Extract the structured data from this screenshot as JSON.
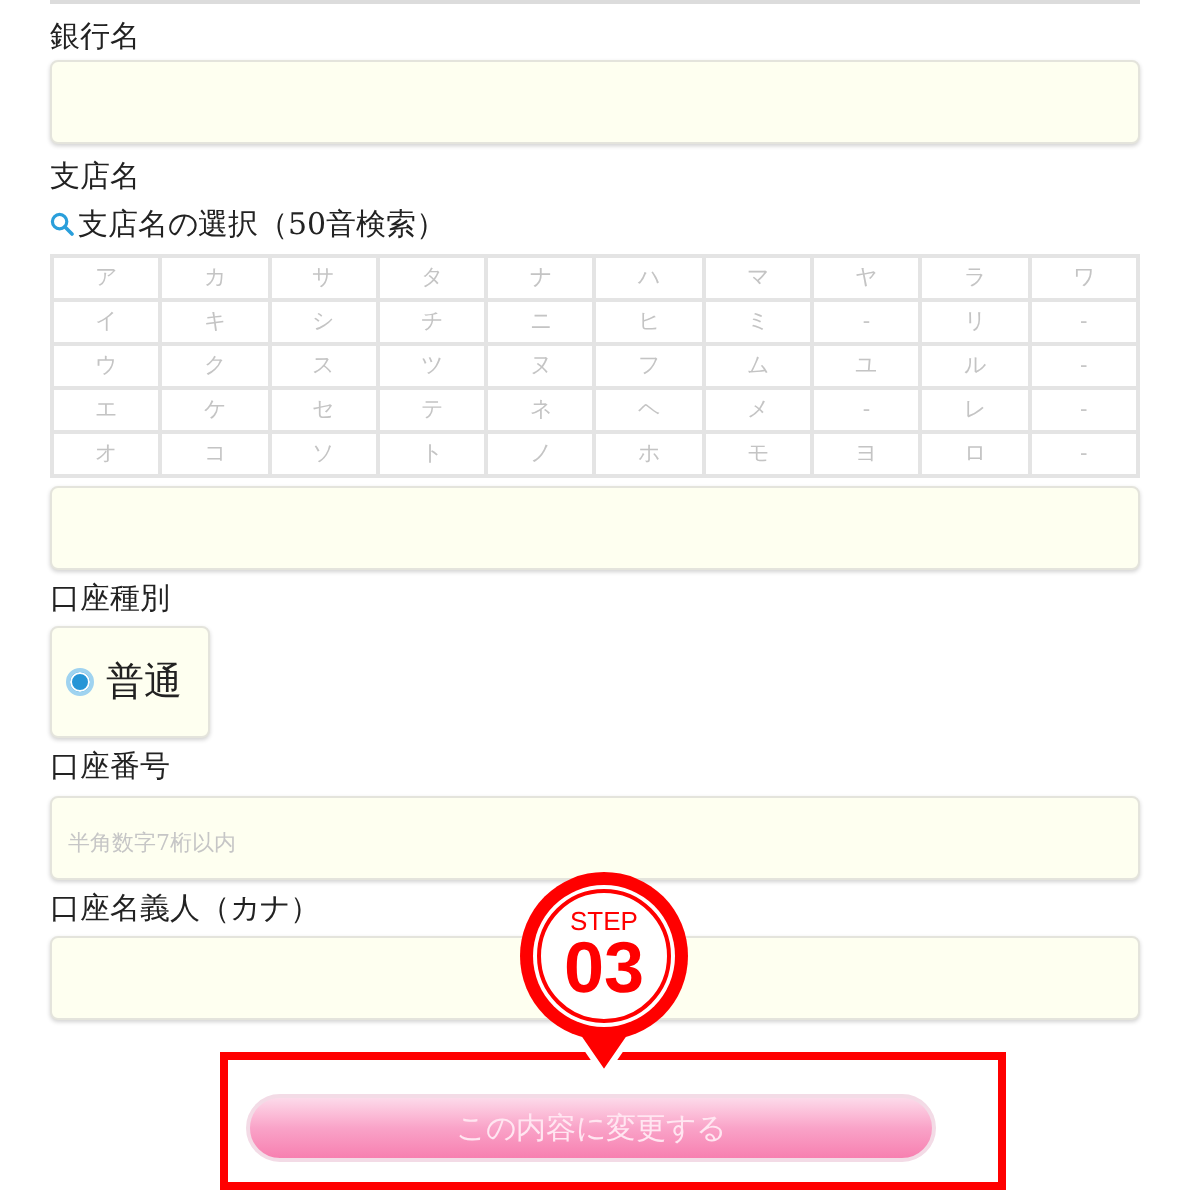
{
  "bank_name": {
    "label": "銀行名"
  },
  "branch": {
    "label": "支店名",
    "search_link": "支店名の選択（50音検索）",
    "kana_table": [
      [
        "ア",
        "カ",
        "サ",
        "タ",
        "ナ",
        "ハ",
        "マ",
        "ヤ",
        "ラ",
        "ワ"
      ],
      [
        "イ",
        "キ",
        "シ",
        "チ",
        "ニ",
        "ヒ",
        "ミ",
        "-",
        "リ",
        "-"
      ],
      [
        "ウ",
        "ク",
        "ス",
        "ツ",
        "ヌ",
        "フ",
        "ム",
        "ユ",
        "ル",
        "-"
      ],
      [
        "エ",
        "ケ",
        "セ",
        "テ",
        "ネ",
        "ヘ",
        "メ",
        "-",
        "レ",
        "-"
      ],
      [
        "オ",
        "コ",
        "ソ",
        "ト",
        "ノ",
        "ホ",
        "モ",
        "ヨ",
        "ロ",
        "-"
      ]
    ]
  },
  "account_type": {
    "label": "口座種別",
    "options": [
      {
        "label": "普通",
        "selected": true
      }
    ]
  },
  "account_number": {
    "label": "口座番号",
    "placeholder": "半角数字7桁以内"
  },
  "account_holder": {
    "label": "口座名義人（カナ）"
  },
  "submit_button": {
    "label": "この内容に変更する"
  },
  "step_marker": {
    "label": "STEP",
    "number": "03"
  }
}
